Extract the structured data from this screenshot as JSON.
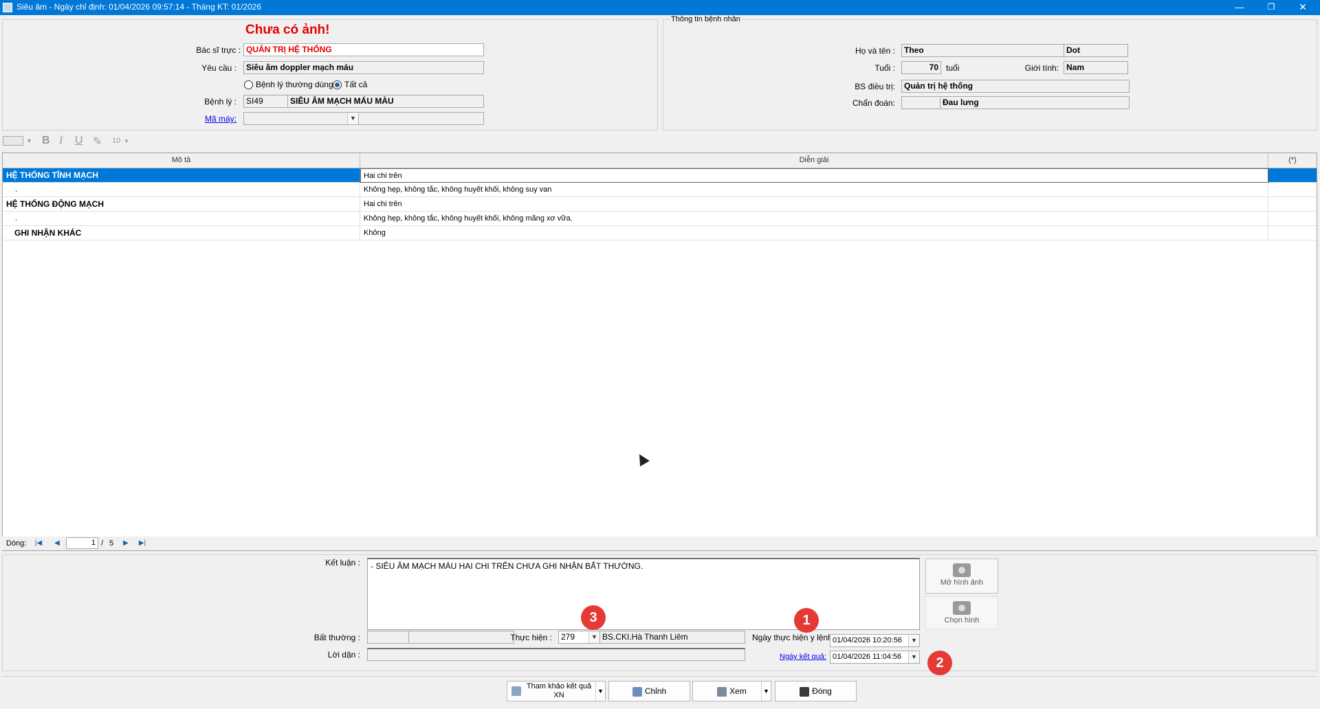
{
  "window": {
    "title": "Siêu âm - Ngày chỉ định: 01/04/2026 09:57:14 - Tháng KT: 01/2026",
    "minimize": "—",
    "restore": "❐",
    "close": "✕"
  },
  "request": {
    "no_image": "Chưa có ảnh!",
    "doctor_label": "Bác sĩ trực :",
    "doctor_value": "QUẢN TRỊ HỆ THỐNG",
    "request_label": "Yêu cầu :",
    "request_value": "Siêu âm doppler mạch máu",
    "radio_common": "Bệnh lý thường dùng",
    "radio_all": "Tất cả",
    "disease_label": "Bệnh lý :",
    "disease_code": "SI49",
    "disease_name": "SIÊU ÂM MẠCH MÁU MÀU",
    "machine_label": "Mã máy:"
  },
  "patient": {
    "section_title": "Thông tin bệnh nhân",
    "name_label": "Họ và tên :",
    "first_name": "Theo",
    "last_name": "Dot",
    "age_label": "Tuổi :",
    "age_value": "70",
    "age_unit": "tuổi",
    "gender_label": "Giới tính:",
    "gender_value": "Nam",
    "treating_label": "BS điều trị:",
    "treating_value": "Quản trị hệ thống",
    "diagnosis_label": "Chẩn đoán:",
    "diagnosis_value": "Đau lưng"
  },
  "toolbar": {
    "bold": "B",
    "italic": "I",
    "underline": "U",
    "font_size": "10"
  },
  "grid": {
    "headers": [
      "Mô tả",
      "Diễn giải",
      "(*)"
    ],
    "rows": [
      {
        "desc": "HỆ THỐNG TĨNH MẠCH",
        "detail": "Hai chi trên"
      },
      {
        "desc": ".",
        "detail": "Không hẹp, không tắc, không huyết khối, không  suy van"
      },
      {
        "desc": "HỆ THỐNG ĐỘNG MẠCH",
        "detail": "Hai chi trên"
      },
      {
        "desc": ".",
        "detail": "Không hẹp, không tắc, không huyết khối, không mãng xơ vữa."
      },
      {
        "desc": "GHI NHẬN KHÁC",
        "detail": "Không"
      }
    ]
  },
  "navigator": {
    "label": "Dòng:",
    "current": "1",
    "sep": "/",
    "total": "5"
  },
  "result": {
    "conclusion_label": "Kết luận :",
    "conclusion_value": "- SIÊU ÂM MẠCH MÁU HAI CHI TRÊN CHƯA GHI NHẬN BẤT THƯỜNG.",
    "abnormal_label": "Bất thường :",
    "performer_label": "Thực hiện :",
    "performer_code": "279",
    "performer_name": "BS.CKI.Hà Thanh Liêm",
    "advice_label": "Lời dặn :",
    "exec_date_label": "Ngày thực hiện y lệnh:",
    "exec_date_value": "01/04/2026 10:20:56",
    "result_date_label": "Ngày kết quả:",
    "result_date_value": "01/04/2026 11:04:56",
    "open_image": "Mở hình ảnh",
    "choose_image": "Chọn hình"
  },
  "badges": [
    "1",
    "2",
    "3"
  ],
  "actions": {
    "reference_line1": "Tham khảo kết quả",
    "reference_line2": "XN",
    "edit": "Chỉnh",
    "view": "Xem",
    "close": "Đóng"
  },
  "colors": {
    "titlebar": "#0078d7",
    "selection": "#0078d7",
    "warning_red": "#e60000",
    "badge_red": "#e53935"
  }
}
